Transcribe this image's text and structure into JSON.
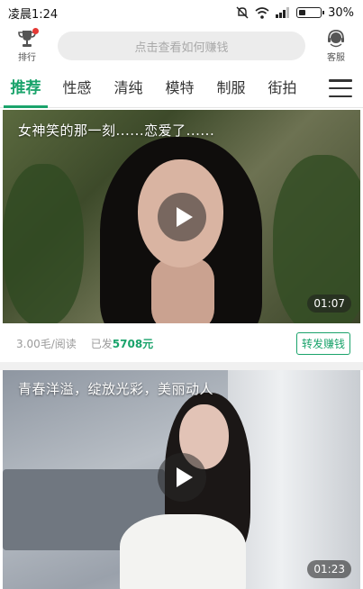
{
  "status_bar": {
    "time": "凌晨1:24",
    "battery": "30%"
  },
  "header": {
    "rank_label": "排行",
    "search_placeholder": "点击查看如何赚钱",
    "service_label": "客服"
  },
  "tabs": [
    {
      "label": "推荐",
      "active": true
    },
    {
      "label": "性感",
      "active": false
    },
    {
      "label": "清纯",
      "active": false
    },
    {
      "label": "模特",
      "active": false
    },
    {
      "label": "制服",
      "active": false
    },
    {
      "label": "街拍",
      "active": false
    }
  ],
  "feed": [
    {
      "title": "女神笑的那一刻......恋爱了......",
      "duration": "01:07",
      "price": "3.00毛/阅读",
      "sent_label": "已发",
      "sent_amount": "5708元",
      "share_label": "转发赚钱"
    },
    {
      "title": "青春洋溢，绽放光彩，美丽动人",
      "duration": "01:23"
    }
  ],
  "colors": {
    "accent": "#1aa36b",
    "badge": "#e53935"
  }
}
